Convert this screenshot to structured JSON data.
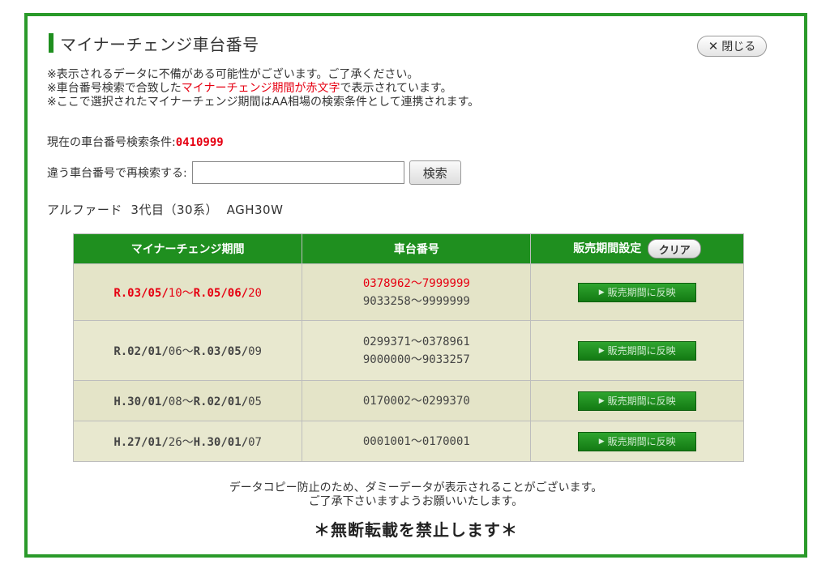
{
  "header": {
    "title": "マイナーチェンジ車台番号",
    "close_label": "閉じる",
    "close_icon": "✕"
  },
  "notes": {
    "line1": "※表示されるデータに不備がある可能性がございます。ご了承ください。",
    "line2_prefix": "※車台番号検索で合致した",
    "line2_highlight": "マイナーチェンジ期間が赤文字",
    "line2_suffix": "で表示されています。",
    "line3": "※ここで選択されたマイナーチェンジ期間はAA相場の検索条件として連携されます。"
  },
  "search": {
    "condition_label": "現在の車台番号検索条件:",
    "condition_value": "0410999",
    "research_label": "違う車台番号で再検索する:",
    "input_value": "",
    "button_label": "検索"
  },
  "model": {
    "name": "アルファード",
    "generation": "3代目（30系）",
    "code": "AGH30W"
  },
  "table": {
    "headers": {
      "period": "マイナーチェンジ期間",
      "serial": "車台番号",
      "sales": "販売期間設定",
      "clear_label": "クリア"
    },
    "apply_label": "販売期間に反映",
    "rows": [
      {
        "start_main": "R.03/05/",
        "start_day": "10",
        "tilde": "〜",
        "end_main": "R.05/06/",
        "end_day": "20",
        "serial1": "0378962〜7999999",
        "serial2": "9033258〜9999999",
        "highlighted": true
      },
      {
        "start_main": "R.02/01/",
        "start_day": "06",
        "tilde": "〜",
        "end_main": "R.03/05/",
        "end_day": "09",
        "serial1": "0299371〜0378961",
        "serial2": "9000000〜9033257",
        "highlighted": false
      },
      {
        "start_main": "H.30/01/",
        "start_day": "08",
        "tilde": "〜",
        "end_main": "R.02/01/",
        "end_day": "05",
        "serial1": "0170002〜0299370",
        "serial2": "",
        "highlighted": false
      },
      {
        "start_main": "H.27/01/",
        "start_day": "26",
        "tilde": "〜",
        "end_main": "H.30/01/",
        "end_day": "07",
        "serial1": "0001001〜0170001",
        "serial2": "",
        "highlighted": false
      }
    ]
  },
  "footer": {
    "line1": "データコピー防止のため、ダミーデータが表示されることがございます。",
    "line2": "ご了承下さいますようお願いいたします。",
    "warning": "＊無断転載を禁止します＊"
  },
  "colors": {
    "frame_green": "#2a9a2a",
    "header_green": "#1f8f1f",
    "highlight_red": "#e60012",
    "row_bg": "#e4e4c8"
  }
}
